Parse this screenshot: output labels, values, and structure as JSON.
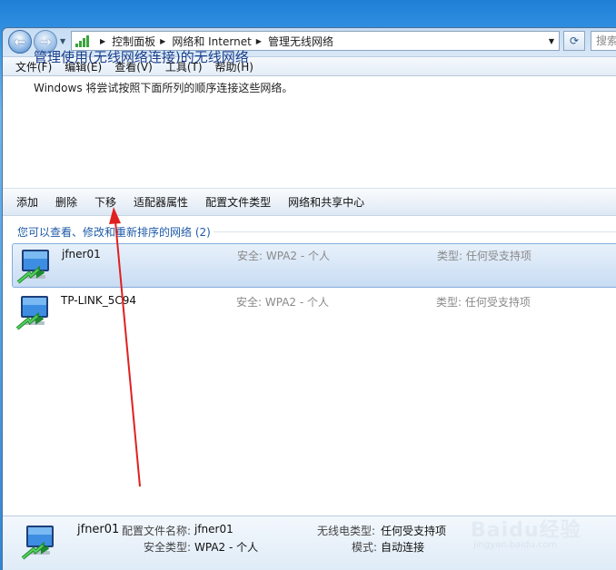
{
  "nav": {
    "back_label": "←",
    "forward_label": "→",
    "breadcrumb": [
      "控制面板",
      "网络和 Internet",
      "管理无线网络"
    ],
    "search_placeholder": "搜索"
  },
  "menu": [
    "文件(F)",
    "编辑(E)",
    "查看(V)",
    "工具(T)",
    "帮助(H)"
  ],
  "header": {
    "title": "管理使用(无线网络连接)的无线网络",
    "description": "Windows 将尝试按照下面所列的顺序连接这些网络。"
  },
  "commands": [
    "添加",
    "删除",
    "下移",
    "适配器属性",
    "配置文件类型",
    "网络和共享中心"
  ],
  "list": {
    "group_header": "您可以查看、修改和重新排序的网络 (2)",
    "networks": [
      {
        "name": "jfner01",
        "security": "安全: WPA2 - 个人",
        "type": "类型: 任何受支持项",
        "selected": true
      },
      {
        "name": "TP-LINK_5C94",
        "security": "安全: WPA2 - 个人",
        "type": "类型: 任何受支持项",
        "selected": false
      }
    ]
  },
  "details": {
    "name": "jfner01",
    "profile_label": "配置文件名称:",
    "profile_value": "jfner01",
    "security_label": "安全类型:",
    "security_value": "WPA2 - 个人",
    "radio_label": "无线电类型:",
    "radio_value": "任何受支持项",
    "mode_label": "模式:",
    "mode_value": "自动连接"
  },
  "watermark": {
    "text": "Baidu经验",
    "sub": "jingyan.baidu.com"
  },
  "colors": {
    "accent": "#1a3f8c",
    "link": "#1e5aa8",
    "annotation_arrow": "#e02020"
  }
}
